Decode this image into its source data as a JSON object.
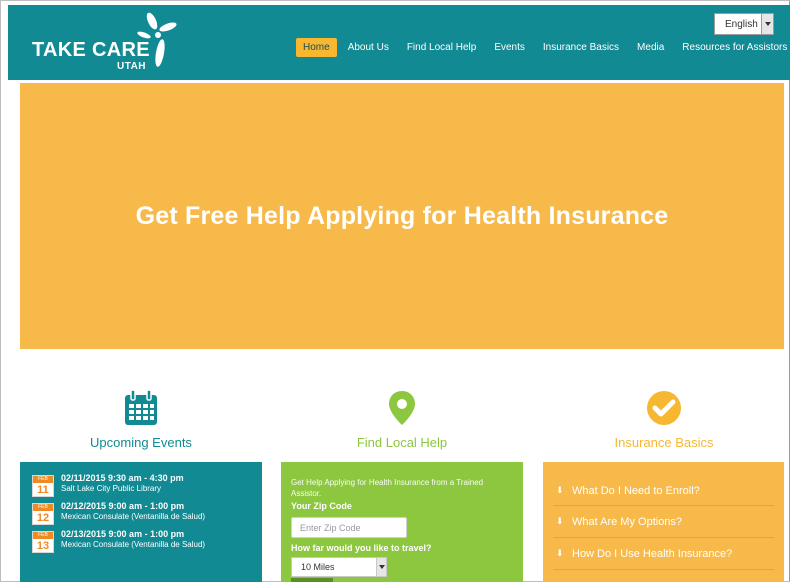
{
  "header": {
    "logo_main": "TAKE CARE",
    "logo_sub": "UTAH",
    "language": "English",
    "nav": [
      {
        "label": "Home",
        "active": true
      },
      {
        "label": "About Us",
        "active": false
      },
      {
        "label": "Find Local Help",
        "active": false
      },
      {
        "label": "Events",
        "active": false
      },
      {
        "label": "Insurance Basics",
        "active": false
      },
      {
        "label": "Media",
        "active": false
      },
      {
        "label": "Resources for Assistors",
        "active": false,
        "has_dropdown": true
      }
    ]
  },
  "hero": {
    "title": "Get Free Help Applying for Health Insurance"
  },
  "features": {
    "events": {
      "title": "Upcoming Events",
      "icon": "calendar-icon",
      "color": "#118a93"
    },
    "help": {
      "title": "Find Local Help",
      "icon": "map-pin-icon",
      "color": "#8dc63f"
    },
    "basics": {
      "title": "Insurance Basics",
      "icon": "check-circle-icon",
      "color": "#f7b731"
    }
  },
  "events": [
    {
      "month": "FEB",
      "day": "11",
      "date": "02/11/2015 9:30 am - 4:30 pm",
      "location": "Salt Lake City Public Library"
    },
    {
      "month": "FEB",
      "day": "12",
      "date": "02/12/2015 9:00 am - 1:00 pm",
      "location": "Mexican Consulate (Ventanilla de Salud)"
    },
    {
      "month": "FEB",
      "day": "13",
      "date": "02/13/2015 9:00 am - 1:00 pm",
      "location": "Mexican Consulate (Ventanilla de Salud)"
    }
  ],
  "help_form": {
    "intro": "Get Help Applying for Health Insurance from a Trained Assistor.",
    "zip_label": "Your Zip Code",
    "zip_placeholder": "Enter Zip Code",
    "travel_label": "How far would you like to travel?",
    "travel_value": "10 Miles"
  },
  "faq": [
    {
      "label": "What Do I Need to Enroll?"
    },
    {
      "label": "What Are My Options?"
    },
    {
      "label": "How Do I Use Health Insurance?"
    }
  ],
  "colors": {
    "teal": "#118a93",
    "orange": "#f7b94a",
    "green": "#8dc63f",
    "nav_active": "#f7b731"
  }
}
